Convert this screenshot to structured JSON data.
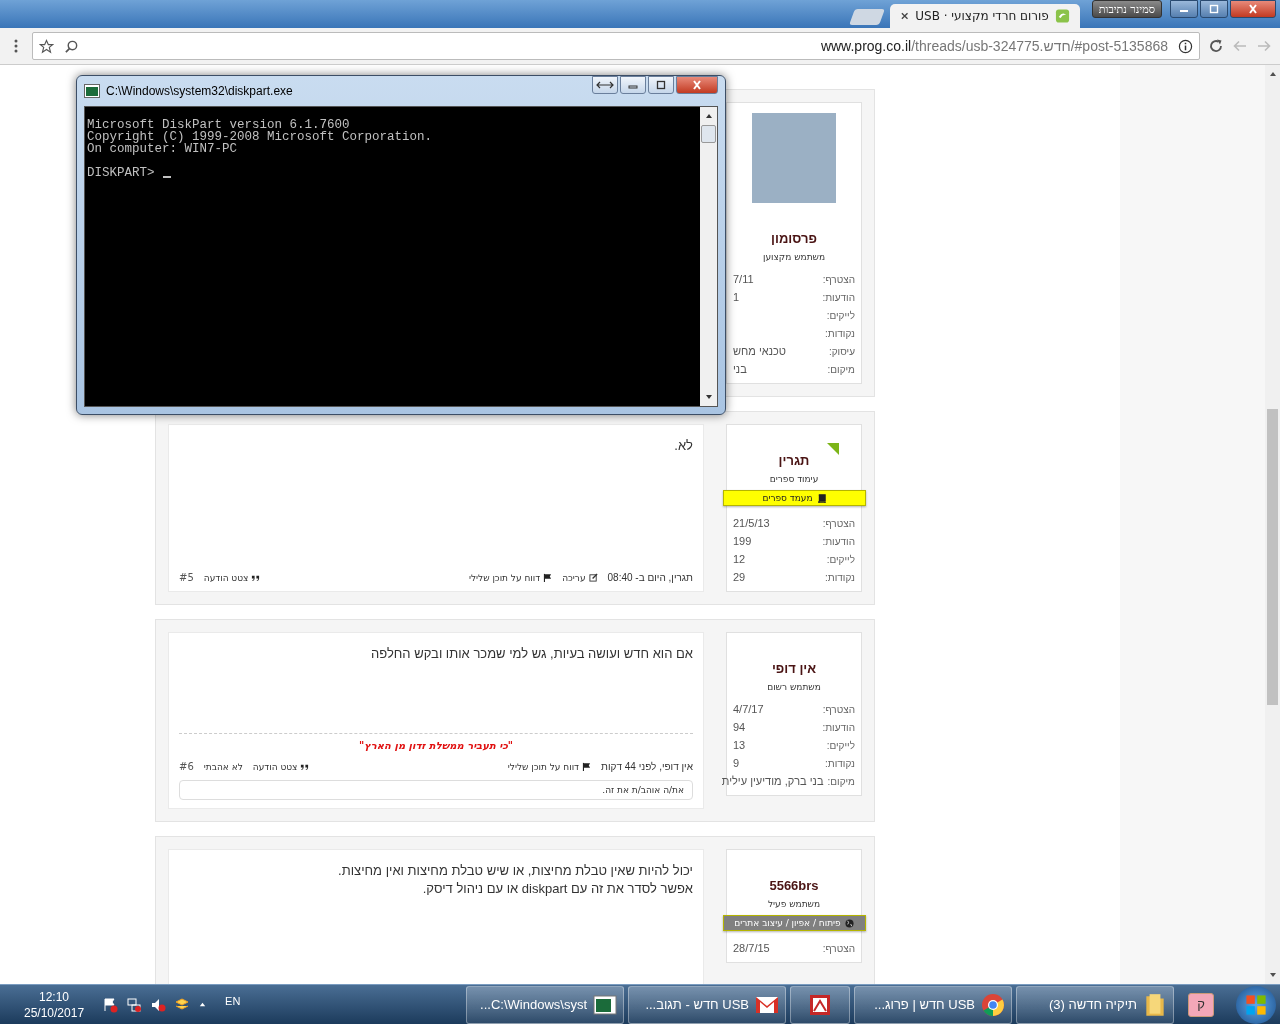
{
  "browser": {
    "profile": "סמינר נתיבות",
    "tab": {
      "title": "פורום חרדי מקצועי · USB"
    },
    "address": {
      "domain": "www.prog.co.il",
      "path": "/threads/usb-324775.חדש/#post-5135868"
    }
  },
  "posts": [
    {
      "user": {
        "name": "פרסומון",
        "title": "משתמש מקצוען",
        "avatar": true
      },
      "stats": [
        {
          "label": "הצטרף:",
          "value": "7/11"
        },
        {
          "label": "הודעות:",
          "value": "1"
        },
        {
          "label": "לייקים:"
        },
        {
          "label": "נקודות:"
        },
        {
          "label": "עיסוק:",
          "value": "טכנאי מחש"
        },
        {
          "label": "מיקום:",
          "value": "בני"
        }
      ]
    },
    {
      "user": {
        "name": "תגרין",
        "title": "עימוד ספרים",
        "online": true,
        "banner": {
          "kind": "book",
          "text": "מעמד ספרים",
          "color": "#ffff00"
        }
      },
      "stats": [
        {
          "label": "הצטרף:",
          "value": "21/5/13"
        },
        {
          "label": "הודעות:",
          "value": "199"
        },
        {
          "label": "לייקים:",
          "value": "12"
        },
        {
          "label": "נקודות:",
          "value": "29"
        }
      ],
      "message": [
        "לא."
      ],
      "footer": {
        "byline": "תגרין, היום ב- 08:40",
        "actions": [
          {
            "kind": "edit",
            "label": "עריכה"
          },
          {
            "kind": "report",
            "label": "דווח על תוכן שלילי"
          }
        ],
        "controls": [
          {
            "kind": "quote",
            "label": "צטט הודעה"
          },
          {
            "kind": "number",
            "label": "#5"
          }
        ]
      }
    },
    {
      "user": {
        "name": "אין דופי",
        "title": "משתמש רשום"
      },
      "stats": [
        {
          "label": "הצטרף:",
          "value": "4/7/17"
        },
        {
          "label": "הודעות:",
          "value": "94"
        },
        {
          "label": "לייקים:",
          "value": "13"
        },
        {
          "label": "נקודות:",
          "value": "9"
        },
        {
          "label": "מיקום:",
          "value": "בני ברק, מודיעין עילית"
        }
      ],
      "message": [
        "אם הוא חדש ועושה בעיות, גש למי שמכר אותו ובקש החלפה"
      ],
      "signature": "\"כי תעביר ממשלת זדון מן הארץ\"",
      "footer": {
        "byline": "אין דופי, לפני 44 דקות",
        "actions": [
          {
            "kind": "report",
            "label": "דווח על תוכן שלילי"
          }
        ],
        "controls": [
          {
            "kind": "quote",
            "label": "צטט הודעה"
          },
          {
            "kind": "unlike",
            "label": "לא אהבתי"
          },
          {
            "kind": "number",
            "label": "#6"
          }
        ]
      },
      "likes": "את/ה אוהב/ת את זה."
    },
    {
      "user": {
        "name": "5566brs",
        "title": "משתמש פעיל",
        "banner": {
          "kind": "globe",
          "text": "פיתוח / אפיון / עיצוב אתרים",
          "color": "#808080"
        }
      },
      "stats": [
        {
          "label": "הצטרף:",
          "value": "28/7/15"
        }
      ],
      "message": [
        "יכול להיות שאין טבלת מחיצות, או שיש טבלת מחיצות ואין מחיצות.",
        "אפשר לסדר את זה עם diskpart או עם ניהול דיסק."
      ]
    }
  ],
  "console": {
    "title": "C:\\Windows\\system32\\diskpart.exe",
    "lines": [
      "Microsoft DiskPart version 6.1.7600",
      "Copyright (C) 1999-2008 Microsoft Corporation.",
      "On computer: WIN7-PC"
    ],
    "prompt": "DISKPART>"
  },
  "taskbar": {
    "pinned": "ק",
    "items": [
      {
        "kind": "folder",
        "label": "תיקיה חדשה (3)"
      },
      {
        "kind": "chrome",
        "label": "USB חדש | פרוג..."
      },
      {
        "kind": "document"
      },
      {
        "kind": "mail",
        "label": "USB חדש - תגוב..."
      },
      {
        "kind": "console",
        "label": "C:\\Windows\\syst..."
      }
    ],
    "language": "EN",
    "time": "12:10",
    "date": "25/10/2017"
  }
}
